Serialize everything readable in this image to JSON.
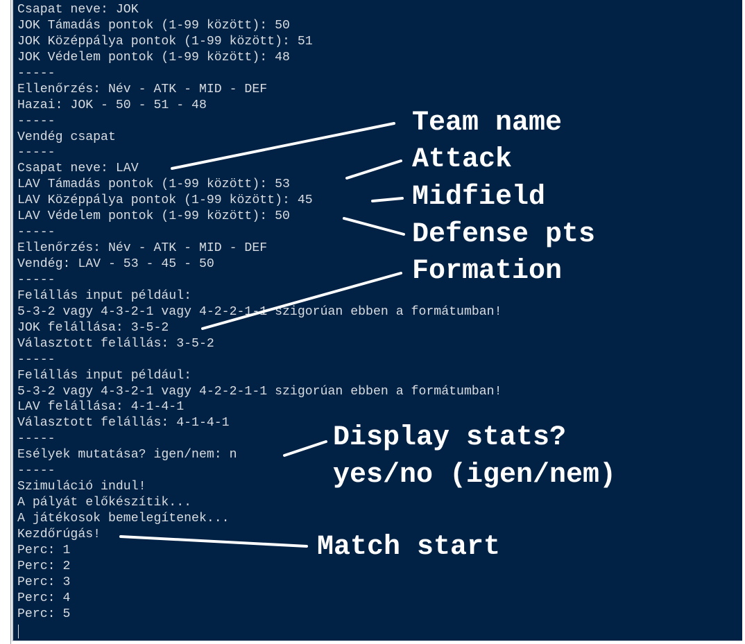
{
  "terminal": {
    "lines": [
      "Csapat neve: JOK",
      "JOK Támadás pontok (1-99 között): 50",
      "JOK Középpálya pontok (1-99 között): 51",
      "JOK Védelem pontok (1-99 között): 48",
      "-----",
      "Ellenőrzés: Név - ATK - MID - DEF",
      "Hazai: JOK - 50 - 51 - 48",
      "-----",
      "Vendég csapat",
      "-----",
      "Csapat neve: LAV",
      "LAV Támadás pontok (1-99 között): 53",
      "LAV Középpálya pontok (1-99 között): 45",
      "LAV Védelem pontok (1-99 között): 50",
      "-----",
      "Ellenőrzés: Név - ATK - MID - DEF",
      "Vendég: LAV - 53 - 45 - 50",
      "-----",
      "Felállás input például:",
      "5-3-2 vagy 4-3-2-1 vagy 4-2-2-1-1 szigorúan ebben a formátumban!",
      "JOK felállása: 3-5-2",
      "Választott felállás: 3-5-2",
      "-----",
      "Felállás input például:",
      "5-3-2 vagy 4-3-2-1 vagy 4-2-2-1-1 szigorúan ebben a formátumban!",
      "LAV felállása: 4-1-4-1",
      "Választott felállás: 4-1-4-1",
      "-----",
      "Esélyek mutatása? igen/nem: n",
      "-----",
      "Szimuláció indul!",
      "A pályát előkészítik...",
      "A játékosok bemelegítenek...",
      "Kezdőrúgás!",
      "Perc: 1",
      "Perc: 2",
      "Perc: 3",
      "Perc: 4",
      "Perc: 5"
    ]
  },
  "annotations": {
    "team_name": "Team name",
    "attack": "Attack",
    "midfield": "Midfield",
    "defense": "Defense pts",
    "formation": "Formation",
    "display_stats": "Display stats?",
    "yes_no": "yes/no (igen/nem)",
    "match_start": "Match start"
  },
  "colors": {
    "terminal_background": "#012244",
    "terminal_text": "#d9dde2",
    "annotation_text": "#ffffff"
  }
}
